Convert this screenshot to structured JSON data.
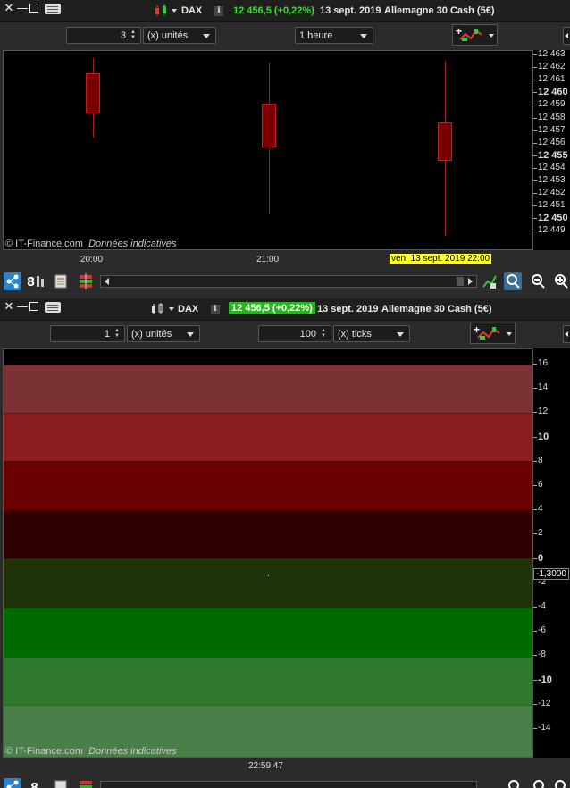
{
  "window1": {
    "instrument": "DAX",
    "price_change": "12 456,5 (+0,22%)",
    "date": "13 sept. 2019",
    "description": "Allemagne 30 Cash (5€)",
    "units_value": "3",
    "units_label": "(x) unités",
    "period": "1 heure",
    "credit_brand": "© IT-Finance.com",
    "credit_note": "Données indicatives",
    "x_labels": [
      "20:00",
      "21:00"
    ],
    "x_highlight": "ven. 13 sept. 2019 22:00",
    "y_labels": [
      {
        "text": "12 463",
        "bold": false
      },
      {
        "text": "12 462",
        "bold": false
      },
      {
        "text": "12 461",
        "bold": false
      },
      {
        "text": "12 460",
        "bold": true
      },
      {
        "text": "12 459",
        "bold": false
      },
      {
        "text": "12 458",
        "bold": false
      },
      {
        "text": "12 457",
        "bold": false
      },
      {
        "text": "12 456",
        "bold": false
      },
      {
        "text": "12 455",
        "bold": true
      },
      {
        "text": "12 454",
        "bold": false
      },
      {
        "text": "12 453",
        "bold": false
      },
      {
        "text": "12 452",
        "bold": false
      },
      {
        "text": "12 451",
        "bold": false
      },
      {
        "text": "12 450",
        "bold": true
      },
      {
        "text": "12 449",
        "bold": false
      }
    ],
    "candles": [
      {
        "open": 12461.6,
        "close": 12458.4,
        "high": 12462.8,
        "low": 12456.5,
        "color": "#7a0000"
      },
      {
        "open": 12459.2,
        "close": 12455.7,
        "high": 12462.4,
        "low": 12450.4,
        "color": "#7a0000"
      },
      {
        "open": 12457.7,
        "close": 12454.6,
        "high": 12462.6,
        "low": 12448.7,
        "color": "#7a0000"
      }
    ]
  },
  "window2": {
    "instrument": "DAX",
    "price_change": "12 456,5 (+0,22%)",
    "date": "13 sept. 2019",
    "description": "Allemagne 30 Cash (5€)",
    "units_value": "1",
    "units_label": "(x) unités",
    "ticks_value": "100",
    "ticks_label": "(x) ticks",
    "credit_brand": "© IT-Finance.com",
    "credit_note": "Données indicatives",
    "x_label": "22:59:47",
    "cursor_value": "-1,3000",
    "y_labels": [
      {
        "text": "16",
        "bold": false
      },
      {
        "text": "14",
        "bold": false
      },
      {
        "text": "12",
        "bold": false
      },
      {
        "text": "10",
        "bold": true
      },
      {
        "text": "8",
        "bold": false
      },
      {
        "text": "6",
        "bold": false
      },
      {
        "text": "4",
        "bold": false
      },
      {
        "text": "2",
        "bold": false
      },
      {
        "text": "0",
        "bold": true
      },
      {
        "text": "-2",
        "bold": false
      },
      {
        "text": "-4",
        "bold": false
      },
      {
        "text": "-6",
        "bold": false
      },
      {
        "text": "-8",
        "bold": false
      },
      {
        "text": "-10",
        "bold": true
      },
      {
        "text": "-12",
        "bold": false
      },
      {
        "text": "-14",
        "bold": false
      }
    ],
    "bands": [
      {
        "color": "#000000"
      },
      {
        "color": "#7a3232"
      },
      {
        "color": "#8a1e1e"
      },
      {
        "color": "#6a0000"
      },
      {
        "color": "#2e0000"
      },
      {
        "color": "#1e3308"
      },
      {
        "color": "#006a00"
      },
      {
        "color": "#2f7a2f"
      },
      {
        "color": "#4a7f4a"
      }
    ]
  },
  "icons": {
    "share": "share-icon",
    "zoom_in": "zoom-in-icon",
    "zoom_out": "zoom-out-icon"
  }
}
